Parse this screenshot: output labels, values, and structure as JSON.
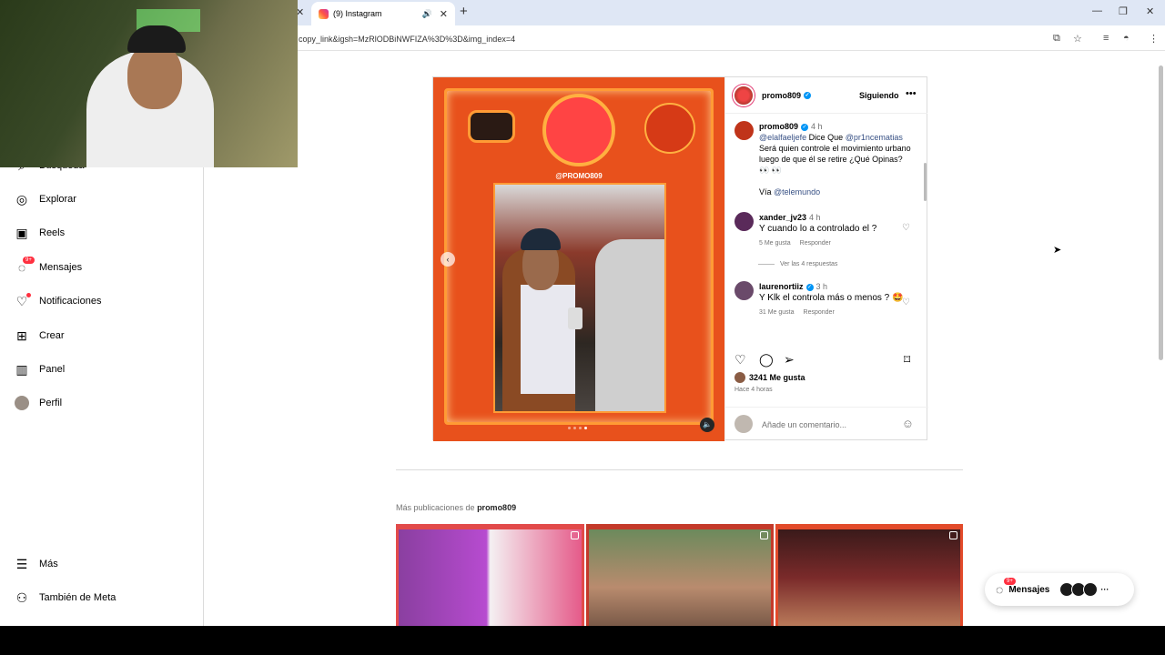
{
  "browser": {
    "tab_title": "(9) Instagram",
    "url": "copy_link&igsh=MzRlODBiNWFIZA%3D%3D&img_index=4"
  },
  "sidebar": {
    "items": [
      {
        "label": "Búsqueda"
      },
      {
        "label": "Explorar"
      },
      {
        "label": "Reels"
      },
      {
        "label": "Mensajes",
        "badge": "9+"
      },
      {
        "label": "Notificaciones"
      },
      {
        "label": "Crear"
      },
      {
        "label": "Panel"
      },
      {
        "label": "Perfil"
      }
    ],
    "bottom": [
      {
        "label": "Más"
      },
      {
        "label": "También de Meta"
      }
    ]
  },
  "post": {
    "media_handle": "@PROMO809",
    "username": "promo809",
    "follow_label": "Siguiendo",
    "caption": {
      "user": "promo809",
      "time": "4 h",
      "mention1": "@elalfaeljefe",
      "text1": " Dice Que ",
      "mention2": "@pr1ncematias",
      "text2": " Será quien controle el movimiento urbano luego de que él se retire ¿Qué Opinas? 👀 👀",
      "via_label": "Vía ",
      "via_mention": "@telemundo"
    },
    "comments": [
      {
        "user": "xander_jv23",
        "time": "4 h",
        "text": "Y cuando lo a controlado el ?",
        "likes": "5 Me gusta",
        "reply": "Responder",
        "replies": "Ver las 4 respuestas"
      },
      {
        "user": "laurenortiiz",
        "time": "3 h",
        "text": "Y Klk el controla más o menos ? 🤩",
        "likes": "31 Me gusta",
        "reply": "Responder"
      }
    ],
    "likes": "3241 Me gusta",
    "time_ago": "Hace 4 horas",
    "comment_placeholder": "Añade un comentario..."
  },
  "more_posts": {
    "prefix": "Más publicaciones de ",
    "user": "promo809"
  },
  "messages_pill": {
    "label": "Mensajes",
    "badge": "9+"
  }
}
